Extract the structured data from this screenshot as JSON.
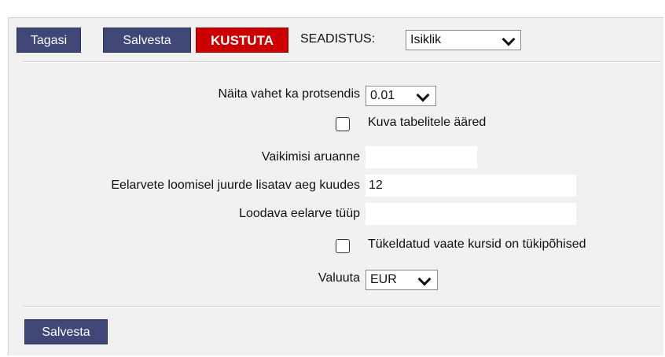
{
  "toolbar": {
    "back_label": "Tagasi",
    "save_label": "Salvesta",
    "delete_label": "KUSTUTA",
    "settings_label": "SEADISTUS:",
    "settings_value": "Isiklik"
  },
  "form": {
    "diff_percent_label": "Näita vahet ka protsendis",
    "diff_percent_value": "0.01",
    "table_borders_label": "Kuva tabelitele ääred",
    "table_borders_checked": false,
    "default_report_label": "Vaikimisi aruanne",
    "default_report_value": "",
    "months_label": "Eelarvete loomisel juurde lisatav aeg kuudes",
    "months_value": "12",
    "budget_type_label": "Loodava eelarve tüüp",
    "budget_type_value": "",
    "piece_rates_label": "Tükeldatud vaate kursid on tükipõhised",
    "piece_rates_checked": false,
    "currency_label": "Valuuta",
    "currency_value": "EUR"
  },
  "footer": {
    "save_label": "Salvesta"
  },
  "colors": {
    "button_navy": "#3e4775",
    "button_red": "#cc0000",
    "panel_bg": "#f1f1f1"
  }
}
